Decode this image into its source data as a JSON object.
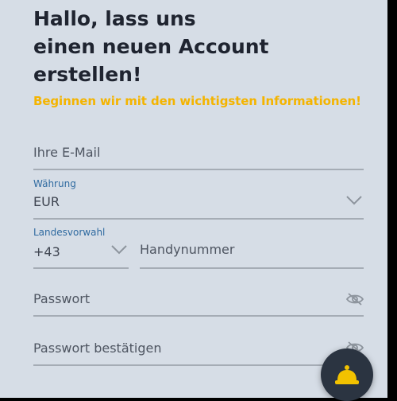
{
  "header": {
    "title_line1": "Hallo, lass uns",
    "title_line2": "einen neuen Account",
    "title_line3": "erstellen!",
    "subtitle": "Beginnen wir mit den wichtigsten Informationen!"
  },
  "form": {
    "email": {
      "placeholder": "Ihre E-Mail"
    },
    "currency": {
      "label": "Währung",
      "value": "EUR"
    },
    "country_code": {
      "label": "Landesvorwahl",
      "value": "+43"
    },
    "phone": {
      "placeholder": "Handynummer"
    },
    "password": {
      "placeholder": "Passwort"
    },
    "password_confirm": {
      "placeholder": "Passwort bestätigen"
    }
  },
  "colors": {
    "background": "#d6dde6",
    "accent": "#f4b400",
    "label_blue": "#2f6aa0",
    "text_dark": "#1f2430"
  },
  "icons": {
    "currency_dropdown": "chevron-down-icon",
    "country_code_dropdown": "chevron-down-icon",
    "password_visibility": "eye-off-icon",
    "password_confirm_visibility": "eye-off-icon",
    "support_button": "bell-icon"
  }
}
